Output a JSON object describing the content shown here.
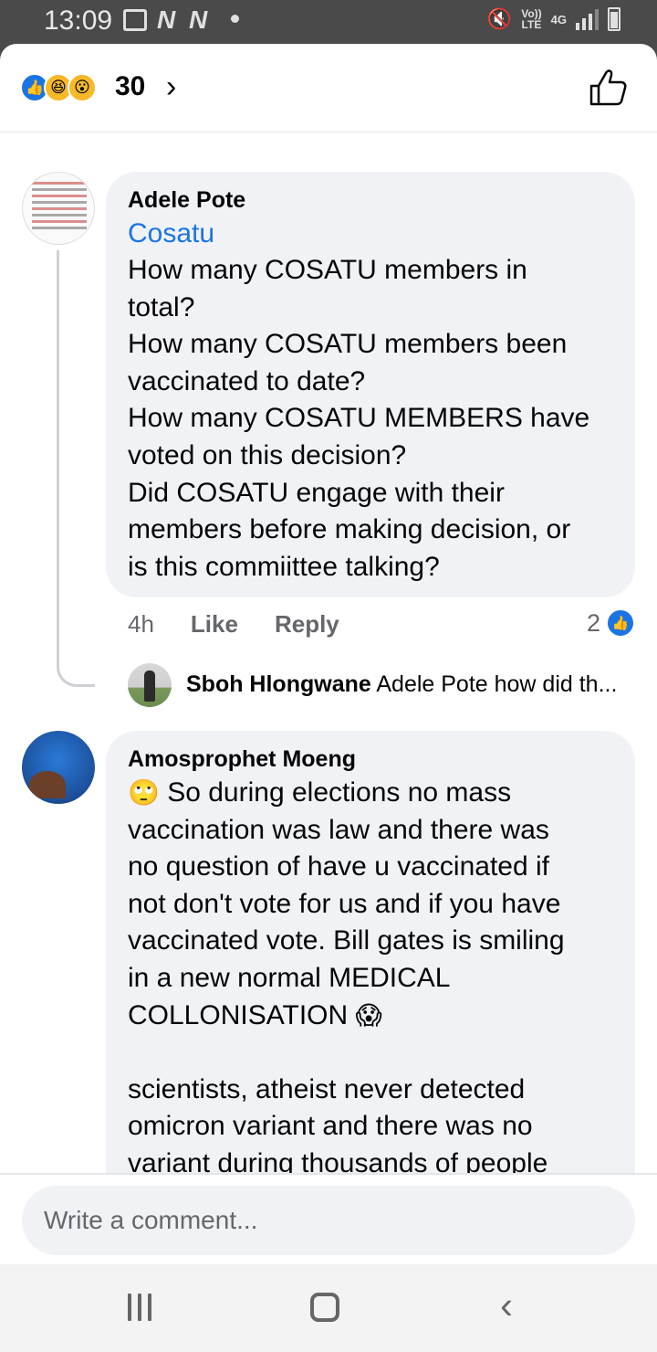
{
  "status_bar": {
    "time": "13:09",
    "left_icons": [
      "image-icon",
      "n-icon",
      "n-icon",
      "dot-icon"
    ],
    "n_glyph": "N",
    "network_line1": "Vo))",
    "network_line2": "LTE",
    "network_type": "4G",
    "right_icons": [
      "mute-icon",
      "volte-icon",
      "signal-icon",
      "battery-icon"
    ]
  },
  "reactions": {
    "icons": [
      "like-icon",
      "haha-icon",
      "wow-icon"
    ],
    "count": "30",
    "chevron": "›"
  },
  "comments": [
    {
      "author": "Adele Pote",
      "tag": "Cosatu",
      "text": "How many COSATU members in\ntotal?\nHow many COSATU members been\nvaccinated to date?\nHow many COSATU MEMBERS have\nvoted on this decision?\nDid COSATU engage with their\nmembers before making decision, or\nis this commiittee talking?",
      "time": "4h",
      "like_label": "Like",
      "reply_label": "Reply",
      "reaction_count": "2",
      "reply_preview": {
        "name": "Sboh Hlongwane",
        "text": "Adele Pote how did th..."
      }
    },
    {
      "author": "Amosprophet Moeng",
      "emoji_start": "🙄",
      "text": "So during elections no mass\nvaccination was law and there was\nno question of have u vaccinated if\nnot don't vote for us and if you have\nvaccinated vote. Bill gates is smiling\nin a new normal MEDICAL\nCOLLONISATION",
      "emoji_end": "😱",
      "text_2": "scientists, atheist never detected\nomicron variant and there was no\nvariant during thousands of people"
    }
  ],
  "composer": {
    "placeholder": "Write a comment..."
  },
  "colors": {
    "accent": "#1b74e4",
    "bubble": "#f0f2f5",
    "status_bar": "#4a4a4a"
  }
}
